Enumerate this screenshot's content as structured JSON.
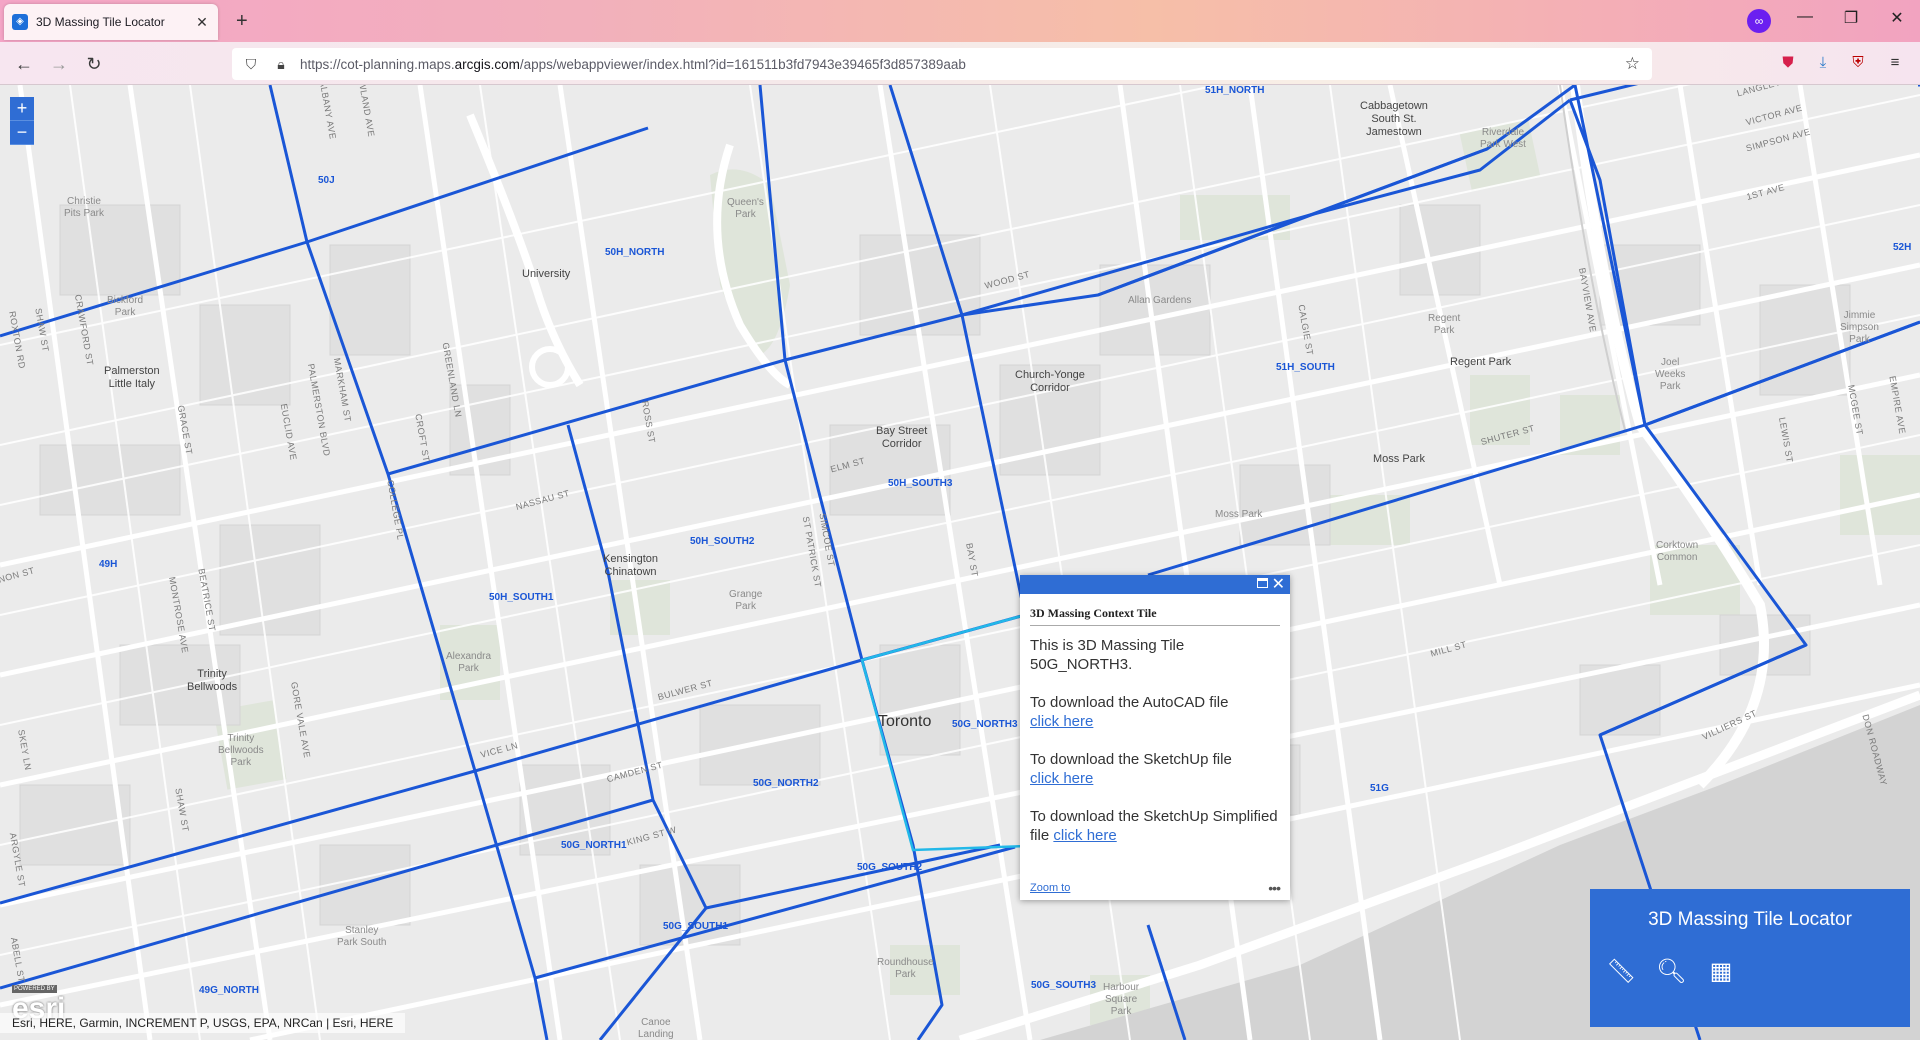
{
  "browser": {
    "tab_title": "3D Massing Tile Locator",
    "tab_close": "✕",
    "new_tab": "+",
    "url_prefix": "https://cot-planning.maps.",
    "url_domain": "arcgis.com",
    "url_suffix": "/apps/webappviewer/index.html?id=161511b3fd7943e39465f3d857389aab",
    "icons": [
      "back-icon",
      "forward-icon",
      "reload-icon",
      "shield-icon",
      "lock-icon",
      "star-icon",
      "pocket-icon",
      "download-icon",
      "ublock-icon",
      "menu-icon",
      "private-browsing-icon"
    ]
  },
  "map": {
    "zoom_in": "+",
    "zoom_out": "−",
    "tiles": [
      {
        "label": "51H_NORTH"
      },
      {
        "label": "50J"
      },
      {
        "label": "50H_NORTH"
      },
      {
        "label": "51H_SOUTH"
      },
      {
        "label": "50H_SOUTH3"
      },
      {
        "label": "50H_SOUTH2"
      },
      {
        "label": "50H_SOUTH1"
      },
      {
        "label": "49H"
      },
      {
        "label": "52H"
      },
      {
        "label": "50G_NORTH3"
      },
      {
        "label": "50G_NORTH2"
      },
      {
        "label": "50G_NORTH1"
      },
      {
        "label": "50G_SOUTH2"
      },
      {
        "label": "50G_SOUTH1"
      },
      {
        "label": "50G_SOUTH3"
      },
      {
        "label": "49G_NORTH"
      },
      {
        "label": "51G"
      }
    ],
    "places": [
      {
        "label": "Cabbagetown\nSouth St.\nJamestown"
      },
      {
        "label": "University"
      },
      {
        "label": "Palmerston\nLittle Italy"
      },
      {
        "label": "Church-Yonge\nCorridor"
      },
      {
        "label": "Bay Street\nCorridor"
      },
      {
        "label": "Regent Park"
      },
      {
        "label": "Moss Park"
      },
      {
        "label": "Kensington\nChinatown"
      },
      {
        "label": "Trinity\nBellwoods"
      }
    ],
    "parks": [
      {
        "label": "Christie\nPits Park"
      },
      {
        "label": "Queen's\nPark"
      },
      {
        "label": "Riverdale\nPark West"
      },
      {
        "label": "Bickford\nPark"
      },
      {
        "label": "Allan Gardens"
      },
      {
        "label": "Regent\nPark"
      },
      {
        "label": "Jimmie\nSimpson\nPark"
      },
      {
        "label": "Joel\nWeeks\nPark"
      },
      {
        "label": "Moss Park"
      },
      {
        "label": "Corktown\nCommon"
      },
      {
        "label": "Grange\nPark"
      },
      {
        "label": "Alexandra\nPark"
      },
      {
        "label": "Trinity\nBellwoods\nPark"
      },
      {
        "label": "Stanley\nPark South"
      },
      {
        "label": "Roundhouse\nPark"
      },
      {
        "label": "Harbour\nSquare\nPark"
      },
      {
        "label": "Canoe\nLanding"
      }
    ],
    "streets": [
      {
        "label": "ALBANY AVE"
      },
      {
        "label": "HOWLAND AVE"
      },
      {
        "label": "SHAW ST"
      },
      {
        "label": "CRAWFORD ST"
      },
      {
        "label": "ROXTON RD"
      },
      {
        "label": "GRACE ST"
      },
      {
        "label": "EUCLID AVE"
      },
      {
        "label": "PALMERSTON BLVD"
      },
      {
        "label": "MARKHAM ST"
      },
      {
        "label": "GREENLAND LN"
      },
      {
        "label": "CROFT ST"
      },
      {
        "label": "COLLEGE PL"
      },
      {
        "label": "NASSAU ST"
      },
      {
        "label": "ROSS ST"
      },
      {
        "label": "ELM ST"
      },
      {
        "label": "SIMCOE ST"
      },
      {
        "label": "ST PATRICK ST"
      },
      {
        "label": "BAY ST"
      },
      {
        "label": "WOOD ST"
      },
      {
        "label": "CALGIE ST"
      },
      {
        "label": "SHUTER ST"
      },
      {
        "label": "BAYVIEW AVE"
      },
      {
        "label": "LANGLEY AVE"
      },
      {
        "label": "VICTOR AVE"
      },
      {
        "label": "SIMPSON AVE"
      },
      {
        "label": "1ST AVE"
      },
      {
        "label": "EMPIRE AVE"
      },
      {
        "label": "MCGEE ST"
      },
      {
        "label": "LEWIS ST"
      },
      {
        "label": "MILL ST"
      },
      {
        "label": "VILLIERS ST"
      },
      {
        "label": "DON ROADWAY"
      },
      {
        "label": "BULWER ST"
      },
      {
        "label": "CAMDEN ST"
      },
      {
        "label": "KING ST W"
      },
      {
        "label": "BEATRICE ST"
      },
      {
        "label": "MONTROSE AVE"
      },
      {
        "label": "GORE VALE AVE"
      },
      {
        "label": "SHAW ST"
      },
      {
        "label": "SKEY LN"
      },
      {
        "label": "ARGYLE ST"
      },
      {
        "label": "ABELL ST"
      },
      {
        "label": "VICE LN"
      },
      {
        "label": "NON ST"
      }
    ],
    "city": "Toronto",
    "shields": [
      "11A",
      "11A",
      "2",
      "2",
      "2",
      "11A",
      "2"
    ]
  },
  "popup": {
    "title": "3D Massing Context Tile",
    "line1": "This is 3D Massing Tile 50G_NORTH3.",
    "autocad_text": "To download the AutoCAD file",
    "sketchup_text": "To download the SketchUp file",
    "simplified_text": "To download the SketchUp Simplified file",
    "link": "click here",
    "zoom_to": "Zoom to",
    "more": "•••"
  },
  "widget": {
    "title": "3D Massing Tile Locator",
    "tools": [
      "measure-icon",
      "search-icon",
      "grid-icon"
    ]
  },
  "footer": {
    "powered_by": "POWERED BY",
    "esri_logo": "esri",
    "attribution": "Esri, HERE, Garmin, INCREMENT P, USGS, EPA, NRCan | Esri, HERE"
  },
  "colors": {
    "tile_line": "#1a56d6",
    "selected_tile": "#22b8e8",
    "widget_bg": "#2f6dd4"
  }
}
